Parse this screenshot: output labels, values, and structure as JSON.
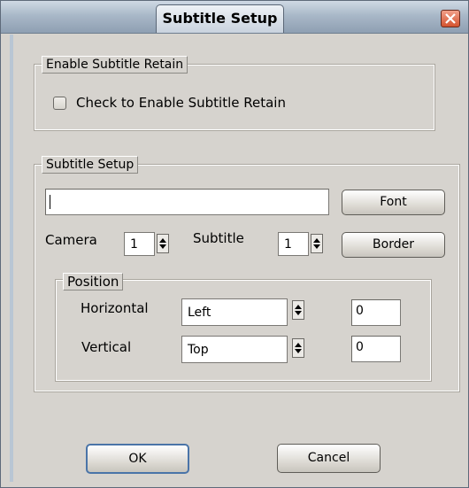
{
  "window": {
    "title": "Subtitle Setup"
  },
  "retain_group": {
    "label": "Enable Subtitle Retain",
    "checkbox_label": "Check to Enable Subtitle Retain",
    "checked": false
  },
  "setup_group": {
    "label": "Subtitle Setup",
    "text_value": "",
    "font_button": "Font",
    "border_button": "Border",
    "camera_label": "Camera",
    "camera_value": "1",
    "subtitle_label": "Subtitle",
    "subtitle_value": "1"
  },
  "position_group": {
    "label": "Position",
    "horizontal_label": "Horizontal",
    "horizontal_value": "Left",
    "horizontal_offset": "0",
    "vertical_label": "Vertical",
    "vertical_value": "Top",
    "vertical_offset": "0"
  },
  "footer": {
    "ok_label": "OK",
    "cancel_label": "Cancel"
  }
}
